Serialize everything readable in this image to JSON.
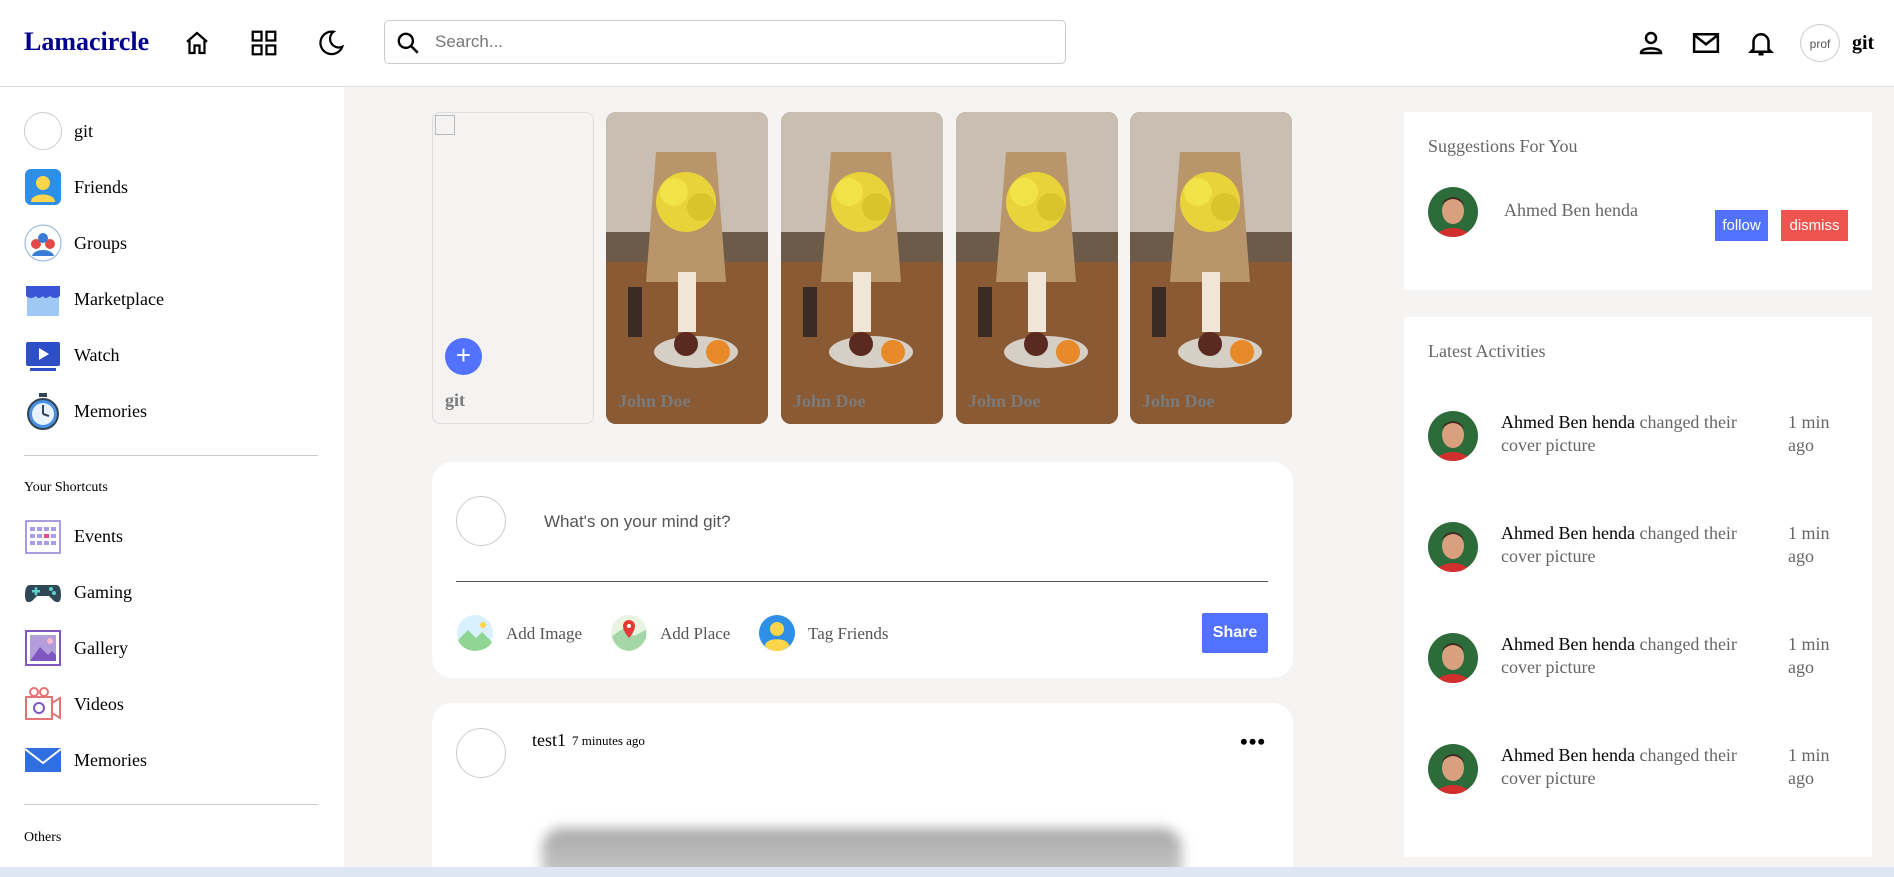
{
  "navbar": {
    "logo": "Lamacircle",
    "search_placeholder": "Search...",
    "avatar_alt": "prof",
    "username": "git"
  },
  "leftbar": {
    "user": "git",
    "menu": [
      {
        "label": "Friends",
        "icon": "friends-icon"
      },
      {
        "label": "Groups",
        "icon": "groups-icon"
      },
      {
        "label": "Marketplace",
        "icon": "marketplace-icon"
      },
      {
        "label": "Watch",
        "icon": "watch-icon"
      },
      {
        "label": "Memories",
        "icon": "memories-icon"
      }
    ],
    "shortcuts_title": "Your Shortcuts",
    "shortcuts": [
      {
        "label": "Events",
        "icon": "events-icon"
      },
      {
        "label": "Gaming",
        "icon": "gaming-icon"
      },
      {
        "label": "Gallery",
        "icon": "gallery-icon"
      },
      {
        "label": "Videos",
        "icon": "videos-icon"
      },
      {
        "label": "Memories",
        "icon": "messages-icon"
      }
    ],
    "others_title": "Others"
  },
  "stories": {
    "mine_name": "git",
    "plus": "+",
    "items": [
      {
        "name": "John Doe"
      },
      {
        "name": "John Doe"
      },
      {
        "name": "John Doe"
      },
      {
        "name": "John Doe"
      }
    ]
  },
  "share": {
    "prompt": "What's on your mind git?",
    "add_image": "Add Image",
    "add_place": "Add Place",
    "tag_friends": "Tag Friends",
    "share_label": "Share"
  },
  "post": {
    "username": "test1",
    "time": "7 minutes ago",
    "more": "•••"
  },
  "suggestions": {
    "title": "Suggestions For You",
    "name": "Ahmed Ben henda",
    "follow": "follow",
    "dismiss": "dismiss"
  },
  "activities": {
    "title": "Latest Activities",
    "items": [
      {
        "name": "Ahmed Ben henda",
        "action": "changed their cover picture",
        "time": "1 min ago"
      },
      {
        "name": "Ahmed Ben henda",
        "action": "changed their cover picture",
        "time": "1 min ago"
      },
      {
        "name": "Ahmed Ben henda",
        "action": "changed their cover picture",
        "time": "1 min ago"
      },
      {
        "name": "Ahmed Ben henda",
        "action": "changed their cover picture",
        "time": "1 min ago"
      }
    ]
  },
  "colors": {
    "accent": "#5271ff",
    "danger": "#f0544f",
    "logo": "#00008b"
  }
}
